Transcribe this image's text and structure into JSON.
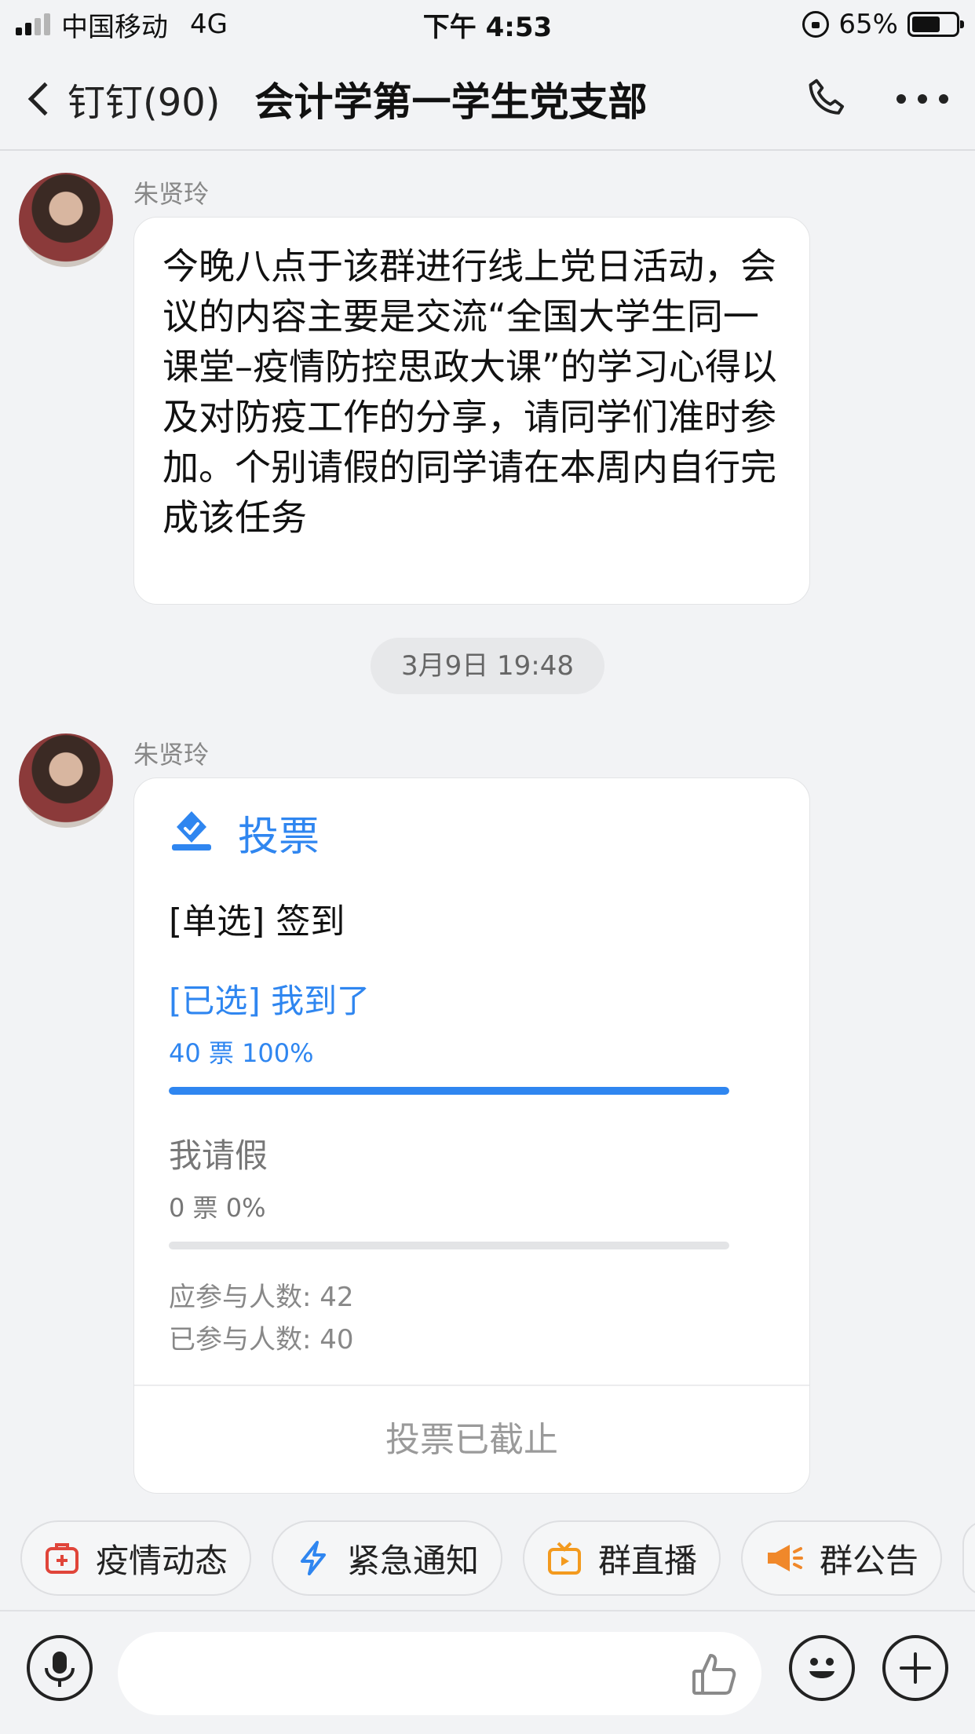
{
  "status_bar": {
    "carrier": "中国移动",
    "network": "4G",
    "time": "下午 4:53",
    "battery": "65%",
    "battery_level": 0.65
  },
  "nav": {
    "back_label": "钉钉(90)",
    "title": "会计学第一学生党支部",
    "phone_icon": "phone-icon",
    "more_icon": "more-icon"
  },
  "messages": [
    {
      "sender": "朱贤玲",
      "text": "今晚八点于该群进行线上党日活动，会议的内容主要是交流“全国大学生同一课堂–疫情防控思政大课”的学习心得以及对防疫工作的分享，请同学们准时参加。个别请假的同学请在本周内自行完成该任务"
    },
    {
      "sender": "朱贤玲"
    }
  ],
  "timestamp": "3月9日 19:48",
  "vote": {
    "title": "投票",
    "question": "[单选] 签到",
    "options": [
      {
        "label": "[已选] 我到了",
        "stats": "40 票   100%",
        "fraction": 1.0
      },
      {
        "label": "我请假",
        "stats": "0 票   0%",
        "fraction": 0.0
      }
    ],
    "expected": "应参与人数: 42",
    "participated": "已参与人数: 40",
    "footer": "投票已截止",
    "accent_color": "#2f86f0"
  },
  "quick_actions": [
    {
      "label": "疫情动态",
      "icon": "medical-kit-icon",
      "color": "#e0453a"
    },
    {
      "label": "紧急通知",
      "icon": "lightning-icon",
      "color": "#2f86f0"
    },
    {
      "label": "群直播",
      "icon": "tv-icon",
      "color": "#f39a1e"
    },
    {
      "label": "群公告",
      "icon": "megaphone-icon",
      "color": "#f0882a"
    }
  ],
  "input_bar": {
    "mic_icon": "microphone-icon",
    "like_icon": "thumbs-up-icon",
    "emoji_icon": "emoji-icon",
    "plus_icon": "plus-icon"
  }
}
